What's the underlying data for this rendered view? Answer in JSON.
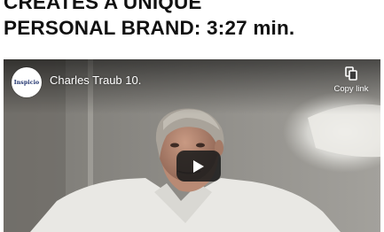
{
  "headline": {
    "line1": "CREATES A UNIQUE",
    "line2": "PERSONAL BRAND: 3:27 min."
  },
  "video": {
    "channel_logo_text": "Inspicio",
    "title": "Charles Traub 10.",
    "copy_link_label": "Copy link",
    "icons": {
      "copy": "copy-icon",
      "play": "play-icon"
    }
  },
  "colors": {
    "play_button_bg": "#1c1c1c",
    "play_glyph": "#ffffff",
    "headline_text": "#111111"
  }
}
